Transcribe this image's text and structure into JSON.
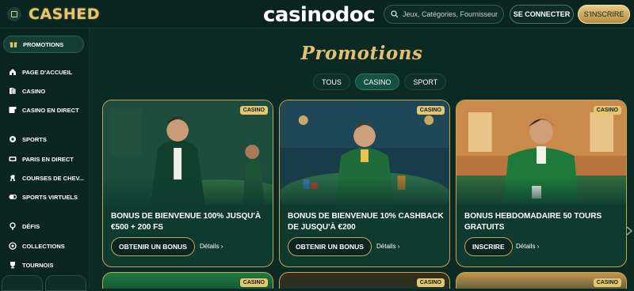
{
  "header": {
    "logo": "CASHED",
    "brand": "casinodoc",
    "search_placeholder": "Jeux, Catégories, Fournisseurs",
    "connect_label": "SE CONNECTER",
    "signup_label": "S'INSCRIRE"
  },
  "sidebar": {
    "items": [
      {
        "label": "PROMOTIONS",
        "icon": "gift-icon"
      },
      {
        "label": "PAGE D'ACCUEIL",
        "icon": "home-icon"
      },
      {
        "label": "CASINO",
        "icon": "cards-icon"
      },
      {
        "label": "CASINO EN DIRECT",
        "icon": "live-cards-icon"
      },
      {
        "label": "SPORTS",
        "icon": "sports-icon"
      },
      {
        "label": "PARIS EN DIRECT",
        "icon": "live-tv-icon"
      },
      {
        "label": "COURSES DE CHEV...",
        "icon": "horse-icon"
      },
      {
        "label": "SPORTS VIRTUELS",
        "icon": "virtual-sports-icon"
      },
      {
        "label": "DÉFIS",
        "icon": "trophy-icon"
      },
      {
        "label": "COLLECTIONS",
        "icon": "collections-icon"
      },
      {
        "label": "TOURNOIS",
        "icon": "cup-icon"
      }
    ]
  },
  "main": {
    "heading": "Promotions",
    "tabs": [
      "TOUS",
      "CASINO",
      "SPORT"
    ],
    "active_tab": "CASINO",
    "cards": [
      {
        "badge": "CASINO",
        "title": "BONUS DE BIENVENUE 100% JUSQU'À €500 + 200 FS",
        "cta": "OBTENIR UN BONUS",
        "details": "Détails"
      },
      {
        "badge": "CASINO",
        "title": "BONUS DE BIENVENUE 10% CASHBACK DE JUSQU'À €200",
        "cta": "OBTENIR UN BONUS",
        "details": "Détails"
      },
      {
        "badge": "CASINO",
        "title": "BONUS HEBDOMADAIRE 50 TOURS GRATUITS",
        "cta": "INSCRIRE",
        "details": "Détails"
      }
    ],
    "lower_cards": [
      {
        "badge": "CASINO"
      },
      {
        "badge": "CASINO"
      },
      {
        "badge": "CASINO"
      }
    ]
  },
  "colors": {
    "gold": "#c7a451",
    "bg": "#0b2a23",
    "card": "#0e3a30"
  }
}
